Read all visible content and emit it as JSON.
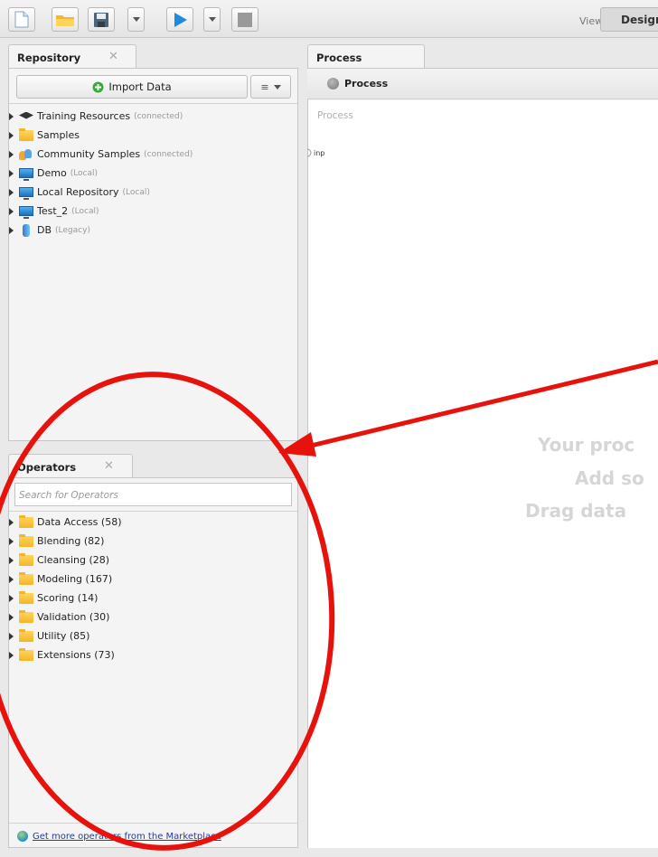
{
  "toolbar": {
    "views_label": "Views:",
    "views_current": "Design"
  },
  "repository": {
    "tab_label": "Repository",
    "import_label": "Import Data",
    "items": [
      {
        "label": "Training Resources",
        "status": "(connected)",
        "icon": "graduation-cap-icon"
      },
      {
        "label": "Samples",
        "status": "",
        "icon": "folder-icon"
      },
      {
        "label": "Community Samples",
        "status": "(connected)",
        "icon": "people-icon"
      },
      {
        "label": "Demo",
        "status": "(Local)",
        "icon": "monitor-icon"
      },
      {
        "label": "Local Repository",
        "status": "(Local)",
        "icon": "monitor-icon"
      },
      {
        "label": "Test_2",
        "status": "(Local)",
        "icon": "monitor-icon"
      },
      {
        "label": "DB",
        "status": "(Legacy)",
        "icon": "database-icon"
      }
    ]
  },
  "operators": {
    "tab_label": "Operators",
    "search_placeholder": "Search for Operators",
    "items": [
      {
        "label": "Data Access (58)"
      },
      {
        "label": "Blending (82)"
      },
      {
        "label": "Cleansing (28)"
      },
      {
        "label": "Modeling (167)"
      },
      {
        "label": "Scoring (14)"
      },
      {
        "label": "Validation (30)"
      },
      {
        "label": "Utility (85)"
      },
      {
        "label": "Extensions (73)"
      }
    ],
    "marketplace_link": "Get more operators from the Marketplace"
  },
  "process": {
    "tab_label": "Process",
    "breadcrumb": "Process",
    "canvas_title": "Process",
    "port_label": "inp",
    "hint_lines": [
      "Your proc",
      "Add so",
      "Drag data"
    ]
  },
  "colors": {
    "annotation_red": "#e8120c",
    "link_blue": "#1b3ea8",
    "folder_yellow": "#f4b52a",
    "hint_gray": "#d6d6d6"
  }
}
